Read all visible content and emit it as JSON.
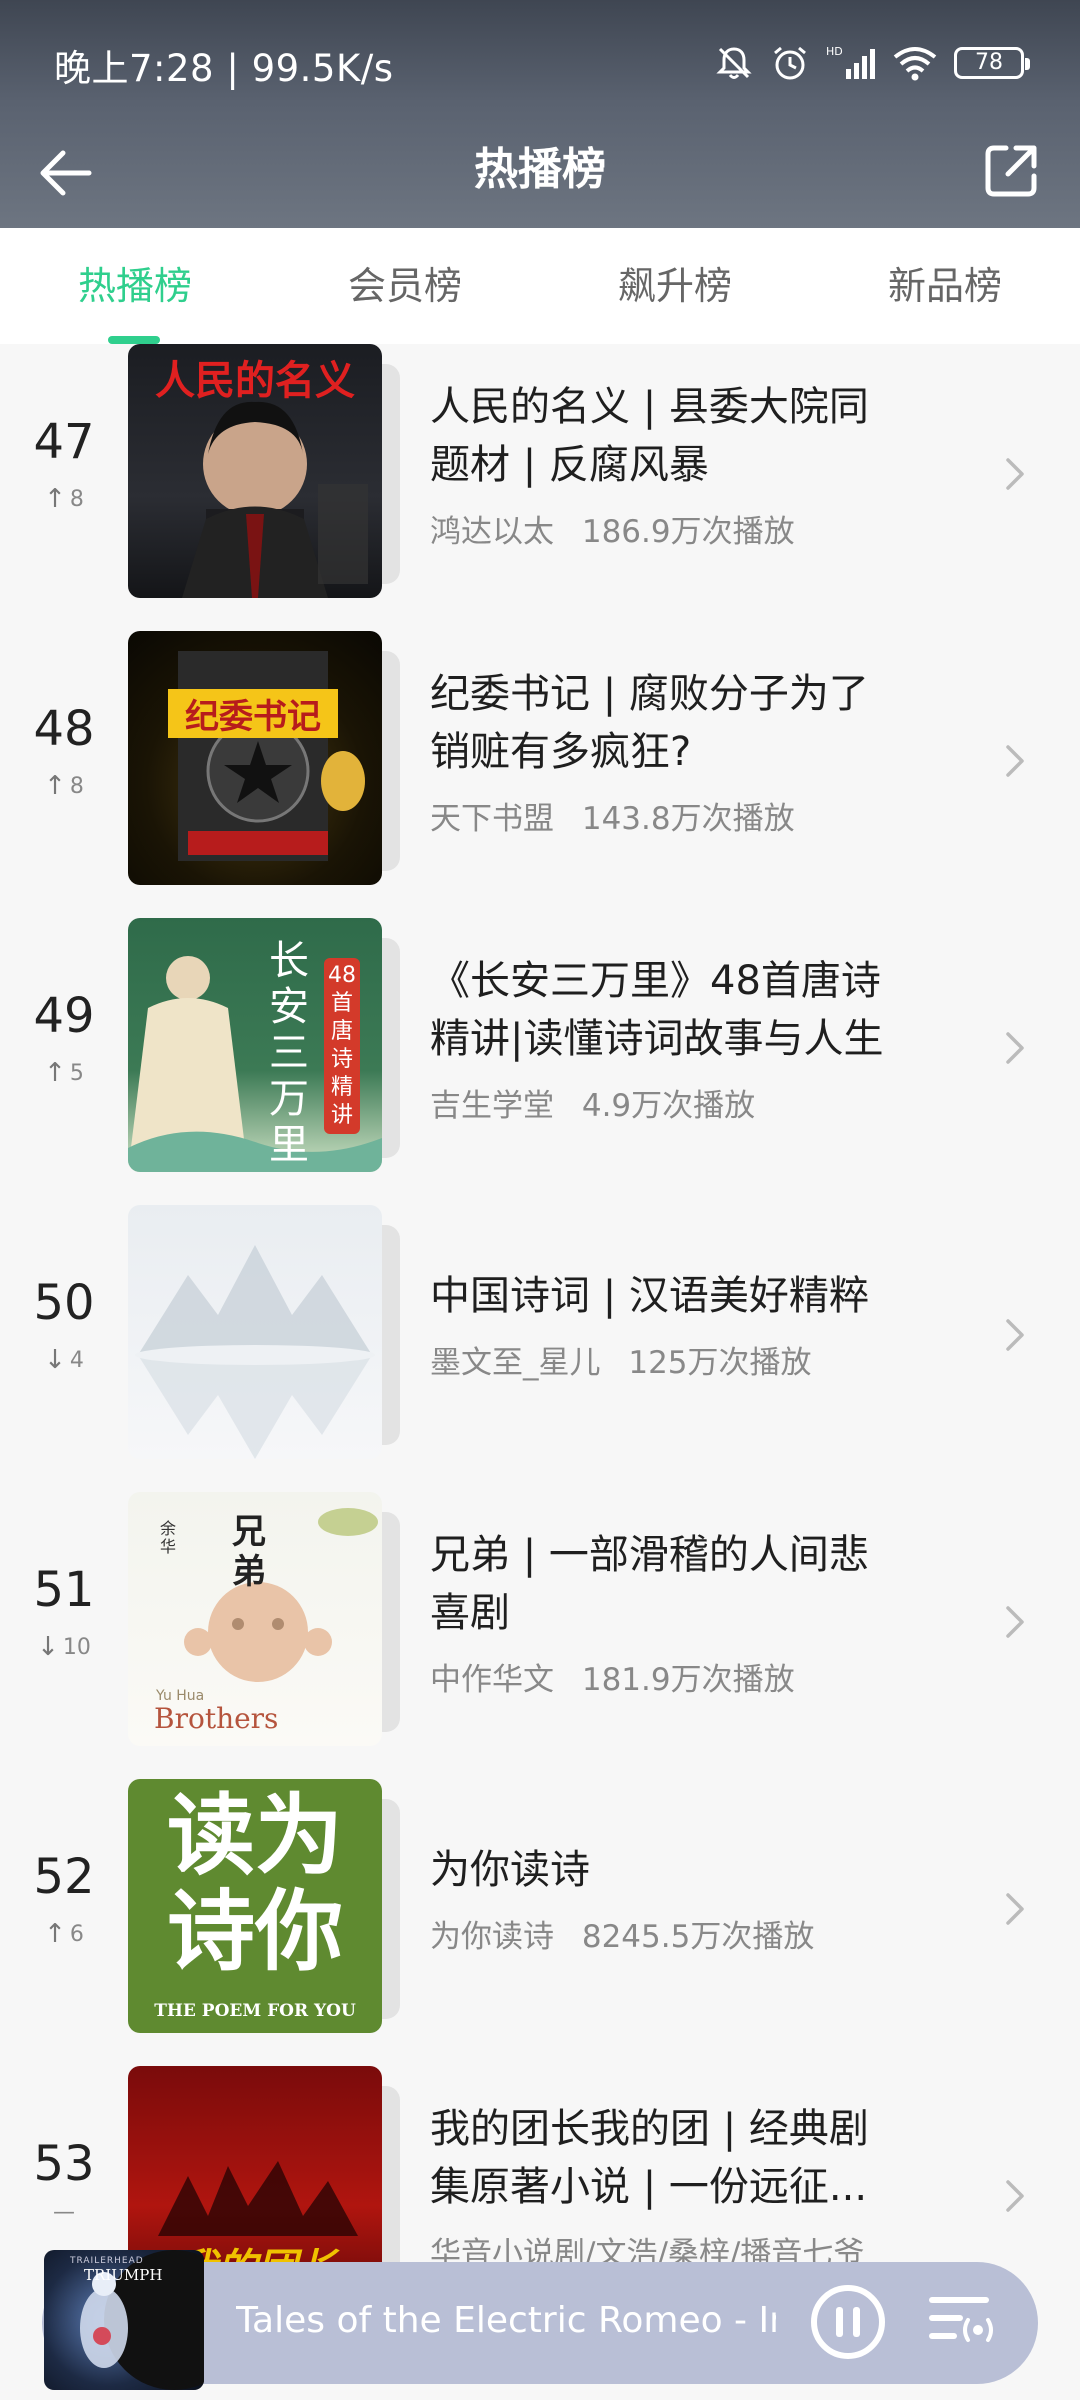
{
  "status": {
    "time": "晚上7:28",
    "speed": "99.5K/s",
    "battery": "78",
    "network": "HD"
  },
  "header": {
    "title": "热播榜"
  },
  "tabs": [
    {
      "label": "热播榜",
      "active": true
    },
    {
      "label": "会员榜",
      "active": false
    },
    {
      "label": "飙升榜",
      "active": false
    },
    {
      "label": "新品榜",
      "active": false
    }
  ],
  "items": [
    {
      "rank": "47",
      "trend": "up",
      "change": "8",
      "title_line1": "人民的名义 | 县委大院同",
      "title_line2": "题材 | 反腐风暴",
      "author": "鸿达以太",
      "plays": "186.9万次播放",
      "cover_text": "人民的名义"
    },
    {
      "rank": "48",
      "trend": "up",
      "change": "8",
      "title_line1": "纪委书记 | 腐败分子为了",
      "title_line2": "销赃有多疯狂?",
      "author": "天下书盟",
      "plays": "143.8万次播放",
      "cover_text": "纪委书记"
    },
    {
      "rank": "49",
      "trend": "up",
      "change": "5",
      "title_line1": "《长安三万里》48首唐诗",
      "title_line2": "精讲|读懂诗词故事与人生",
      "author": "吉生学堂",
      "plays": "4.9万次播放",
      "cover_text": "长安三万里",
      "cover_badge": "48首唐诗精讲"
    },
    {
      "rank": "50",
      "trend": "down",
      "change": "4",
      "title_line1": "中国诗词 | 汉语美好精粹",
      "title_line2": "",
      "author": "墨文至_星儿",
      "plays": "125万次播放"
    },
    {
      "rank": "51",
      "trend": "down",
      "change": "10",
      "title_line1": "兄弟 | 一部滑稽的人间悲",
      "title_line2": "喜剧",
      "author": "中作华文",
      "plays": "181.9万次播放",
      "cover_text": "兄弟",
      "cover_author": "余华",
      "cover_en_small": "Yu Hua",
      "cover_en": "Brothers"
    },
    {
      "rank": "52",
      "trend": "up",
      "change": "6",
      "title_line1": "为你读诗",
      "title_line2": "",
      "author": "为你读诗",
      "plays": "8245.5万次播放",
      "cover_text_a": "读为",
      "cover_text_b": "诗你",
      "cover_en": "THE POEM FOR YOU"
    },
    {
      "rank": "53",
      "trend": "flat",
      "change": "—",
      "title_line1": "我的团长我的团 | 经典剧",
      "title_line2": "集原著小说 | 一份远征...",
      "author": "华音小说剧/文浩/桑梓/播音七爷",
      "plays": "",
      "cover_text": "我的团长"
    }
  ],
  "player": {
    "title": "Tales of the Electric Romeo - Imr",
    "cover_text": "TRIUMPH",
    "cover_label": "TRAILERHEAD"
  },
  "colors": {
    "accent": "#2fcf8d",
    "header_bg": "#545b68",
    "player_bg": "#b9bfd6"
  }
}
